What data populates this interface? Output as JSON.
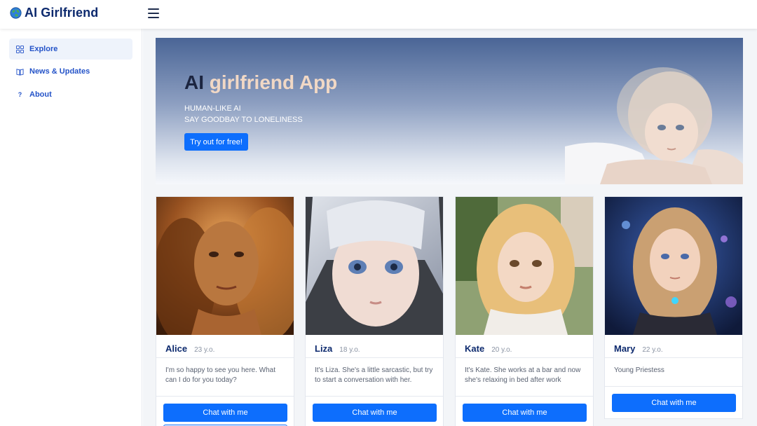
{
  "app": {
    "brand": "AI Girlfriend",
    "brand_icon": "globe-icon",
    "accent_color": "#0d6efd",
    "brand_color": "#0d2a6e"
  },
  "sidebar": {
    "items": [
      {
        "label": "Explore",
        "icon": "grid-icon",
        "active": true
      },
      {
        "label": "News & Updates",
        "icon": "book-icon",
        "active": false
      },
      {
        "label": "About",
        "icon": "question-icon",
        "active": false
      }
    ]
  },
  "hero": {
    "title_dark": "AI",
    "title_light": "girlfriend App",
    "subtitle_line1": "HUMAN-LIKE AI",
    "subtitle_line2": "SAY GOODBAY TO LONELINESS",
    "cta": "Try out for free!"
  },
  "cards": [
    {
      "name": "Alice",
      "age": "23 y.o.",
      "description": "I'm so happy to see you here. What can I do for you today?",
      "button": "Chat with me"
    },
    {
      "name": "Liza",
      "age": "18 y.o.",
      "description": "It's Liza. She's a little sarcastic, but try to start a conversation with her.",
      "button": "Chat with me"
    },
    {
      "name": "Kate",
      "age": "20 y.o.",
      "description": "It's Kate. She works at a bar and now she's relaxing in bed after work",
      "button": "Chat with me"
    },
    {
      "name": "Mary",
      "age": "22 y.o.",
      "description": "Young Priestess",
      "button": "Chat with me"
    }
  ]
}
